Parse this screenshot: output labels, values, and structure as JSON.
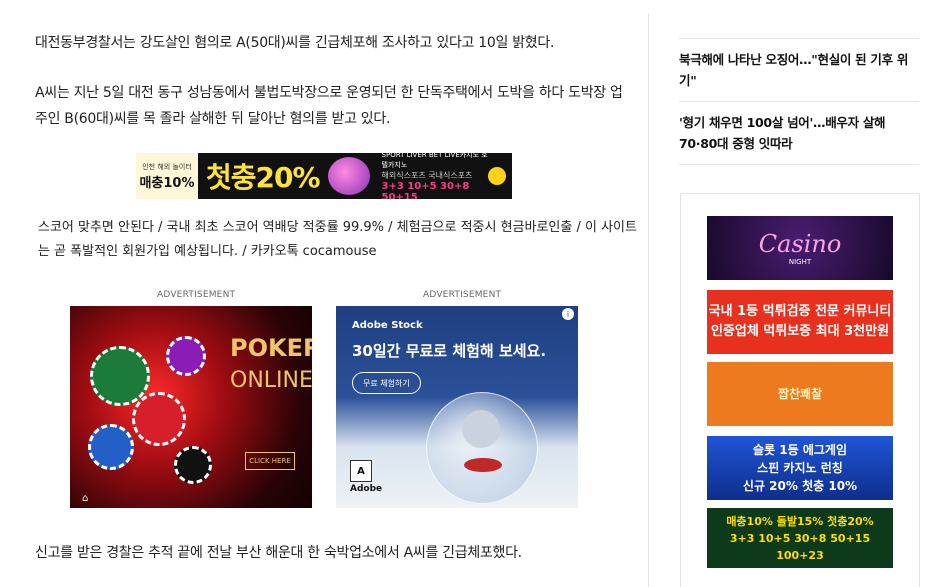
{
  "article": {
    "p1": "대전동부경찰서는 강도살인 혐의로 A(50대)씨를 긴급체포해 조사하고 있다고 10일 밝혔다.",
    "p2": "A씨는 지난 5일 대전 동구 성남동에서 불법도박장으로 운영되던 한 단독주택에서 도박을 하다 도박장 업주인 B(60대)씨를 목 졸라 살해한 뒤 달아난 혐의를 받고 있다.",
    "p3": "신고를 받은 경찰은 추적 끝에 전날 부산 해운대 한 숙박업소에서 A씨를 긴급체포했다."
  },
  "banner1": {
    "left_top": "인천 해외 놀이터",
    "left_main": "매충10%",
    "headline": "첫충20%",
    "right_top": "SPORT LIVER BET  LIVE카지노 호텔카지노",
    "right_mid": "해외식스포츠 국내식스포츠",
    "right_bottom": "3+3 10+5 30+8 50+15"
  },
  "spam_text": "스코어 맞추면 안된다 / 국내 최초 스코어 역배당 적중률 99.9% / 체험금으로 적중시 현금바로인출 / 이 사이트는 곧 폭발적인 회원가입 예상됩니다. / 카카오톡 cocamouse",
  "ads": {
    "label": "ADVERTISEMENT",
    "poker": {
      "title": "POKER",
      "subtitle": "ONLINE",
      "button": "CLICK HERE"
    },
    "adobe": {
      "brand": "Adobe Stock",
      "headline": "30일간 무료로 체험해 보세요.",
      "cta": "무료 체험하기",
      "logo": "Adobe"
    }
  },
  "sidebar": {
    "news": [
      "북극해에 나타난 오징어…\"현실이 된 기후 위기\"",
      "'형기 채우면 100살 넘어'…배우자 살해 70·80대 중형 잇따라"
    ],
    "ads": {
      "casino": {
        "title": "Casino",
        "sub": "NIGHT"
      },
      "ad2": {
        "line1": "국내 1등 먹튀검증 전문 커뮤니티",
        "line2": "인증업체 먹튀보증 최대 3천만원"
      },
      "ad3": {
        "line1": "짭찬쾌찰"
      },
      "ad4": {
        "line1": "슬롯 1등 에그게임",
        "line2": "스핀 카지노 런칭",
        "line3": "신규 20% 첫충 10%"
      },
      "ad5": {
        "line1": "매충10% 돌발15% 첫충20%",
        "line2": "3+3 10+5 30+8 50+15 100+23"
      }
    }
  },
  "colors": {
    "accent_red": "#e8301e",
    "casino_pink": "#f6a8e0",
    "adobe_blue": "#2c5199"
  }
}
